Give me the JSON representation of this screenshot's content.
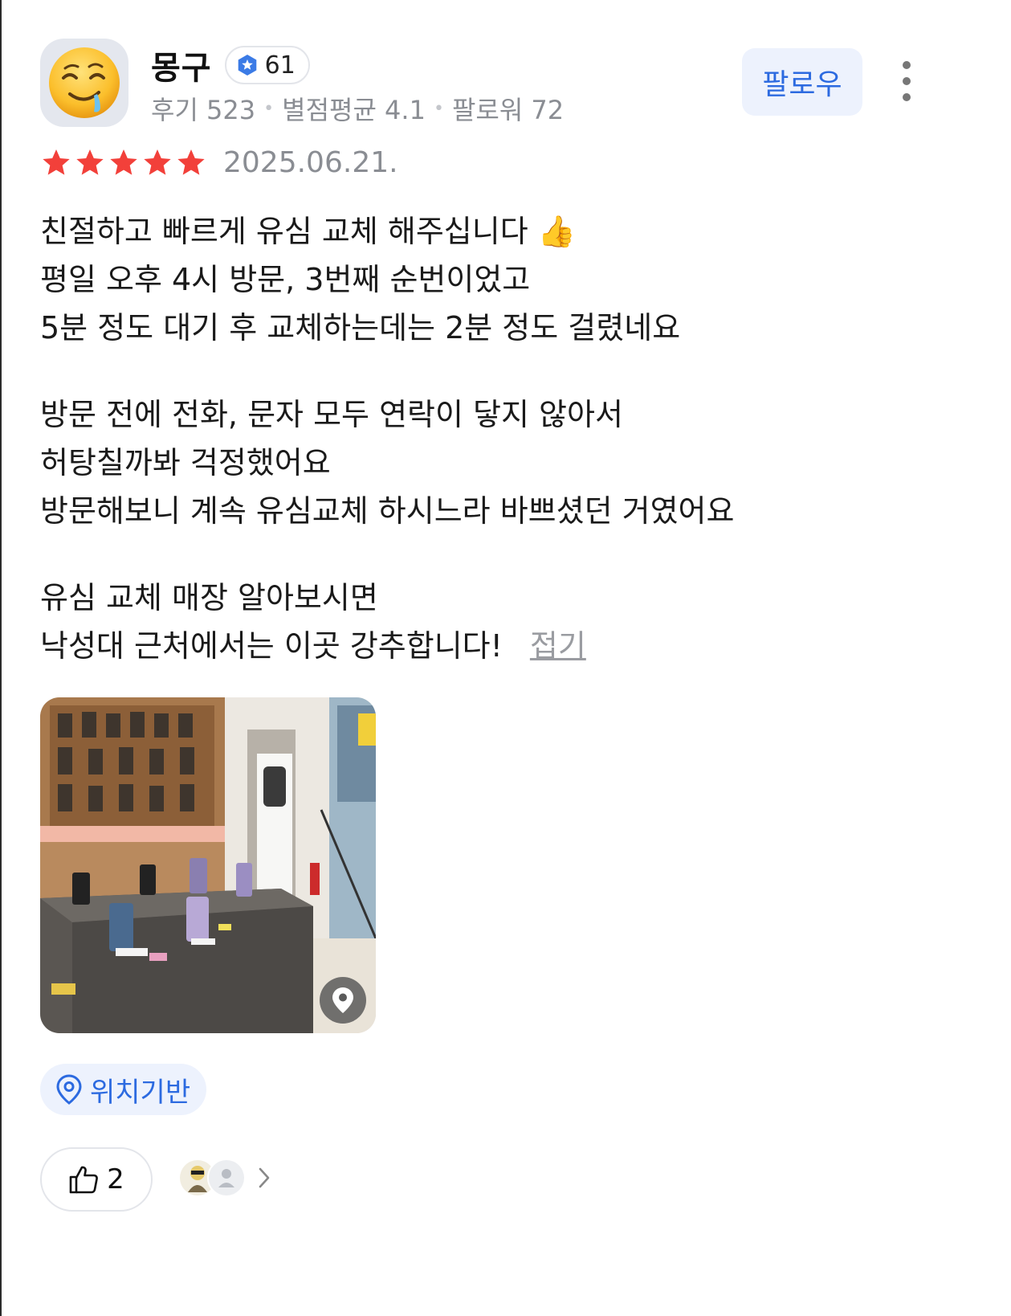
{
  "user": {
    "name": "몽구",
    "level": "61",
    "stats": {
      "reviews": "후기 523",
      "avg_rating": "별점평균 4.1",
      "followers": "팔로워 72"
    },
    "follow_label": "팔로우"
  },
  "review": {
    "rating": 5,
    "max_rating": 5,
    "date": "2025.06.21.",
    "paragraphs": [
      [
        "친절하고 빠르게 유심 교체 해주십니다 👍",
        "평일 오후 4시 방문, 3번째 순번이었고",
        "5분 정도 대기 후 교체하는데는 2분 정도 걸렸네요"
      ],
      [
        "방문 전에 전화, 문자 모두 연락이 닿지 않아서",
        "허탕칠까봐 걱정했어요",
        "방문해보니 계속 유심교체 하시느라 바쁘셨던 거였어요"
      ],
      [
        "유심 교체 매장 알아보시면",
        "낙성대 근처에서는 이곳 강추합니다!"
      ]
    ],
    "collapse_label": "접기"
  },
  "location_tag": "위치기반",
  "likes": {
    "count": "2"
  },
  "colors": {
    "star": "#f2403a",
    "accent": "#2c6ae0",
    "chip_bg": "#edf2fd"
  }
}
